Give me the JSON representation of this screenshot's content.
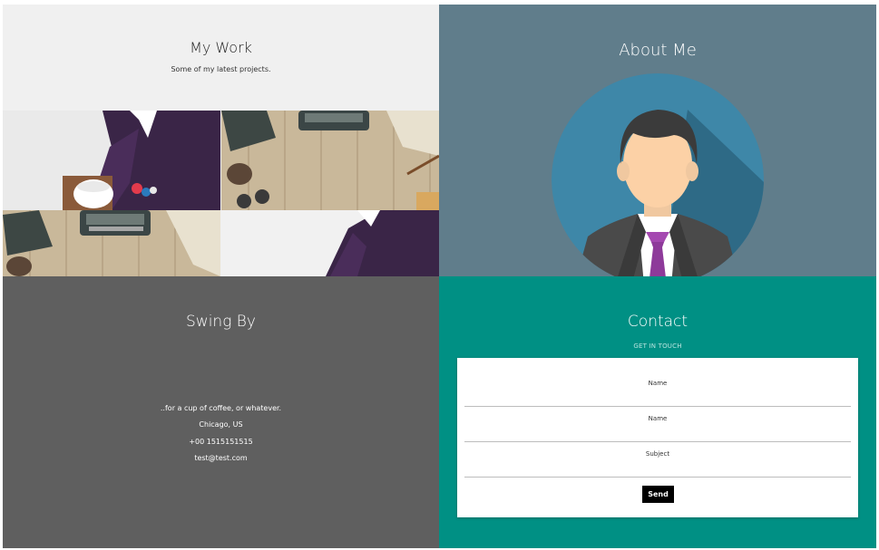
{
  "work": {
    "title": "My Work",
    "subtitle": "Some of my latest projects."
  },
  "about": {
    "title": "About Me"
  },
  "swing": {
    "title": "Swing By",
    "note": "..for a cup of coffee, or whatever.",
    "city": "Chicago, US",
    "phone": "+00 1515151515",
    "email": "test@test.com"
  },
  "contact": {
    "title": "Contact",
    "subtitle": "GET IN TOUCH",
    "fields": [
      {
        "label": "Name"
      },
      {
        "label": "Name"
      },
      {
        "label": "Subject"
      }
    ],
    "send_label": "Send"
  },
  "colors": {
    "work_bg": "#f0f0f0",
    "about_bg": "#607d8b",
    "swing_bg": "#5f5f5f",
    "contact_bg": "#009084"
  }
}
